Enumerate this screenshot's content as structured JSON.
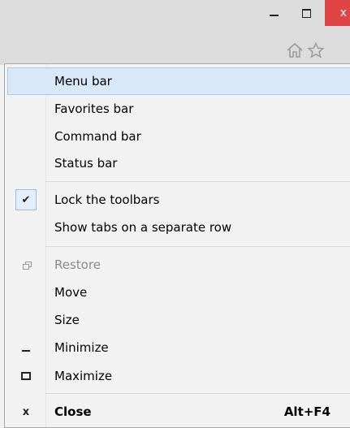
{
  "window": {
    "close_glyph": "x"
  },
  "menu": {
    "items": [
      {
        "label": "Menu bar"
      },
      {
        "label": "Favorites bar"
      },
      {
        "label": "Command bar"
      },
      {
        "label": "Status bar"
      },
      {
        "label": "Lock the toolbars",
        "checked": true
      },
      {
        "label": "Show tabs on a separate row"
      },
      {
        "label": "Restore",
        "disabled": true
      },
      {
        "label": "Move"
      },
      {
        "label": "Size"
      },
      {
        "label": "Minimize"
      },
      {
        "label": "Maximize"
      },
      {
        "label": "Close",
        "shortcut": "Alt+F4",
        "close_glyph": "x"
      }
    ],
    "check_glyph": "✔"
  },
  "colors": {
    "highlight": "#d9e8f7",
    "close_button": "#e04343"
  },
  "icons": [
    "home-icon",
    "star-icon",
    "check-icon",
    "restore-icon",
    "minimize-icon",
    "maximize-icon",
    "close-icon"
  ]
}
